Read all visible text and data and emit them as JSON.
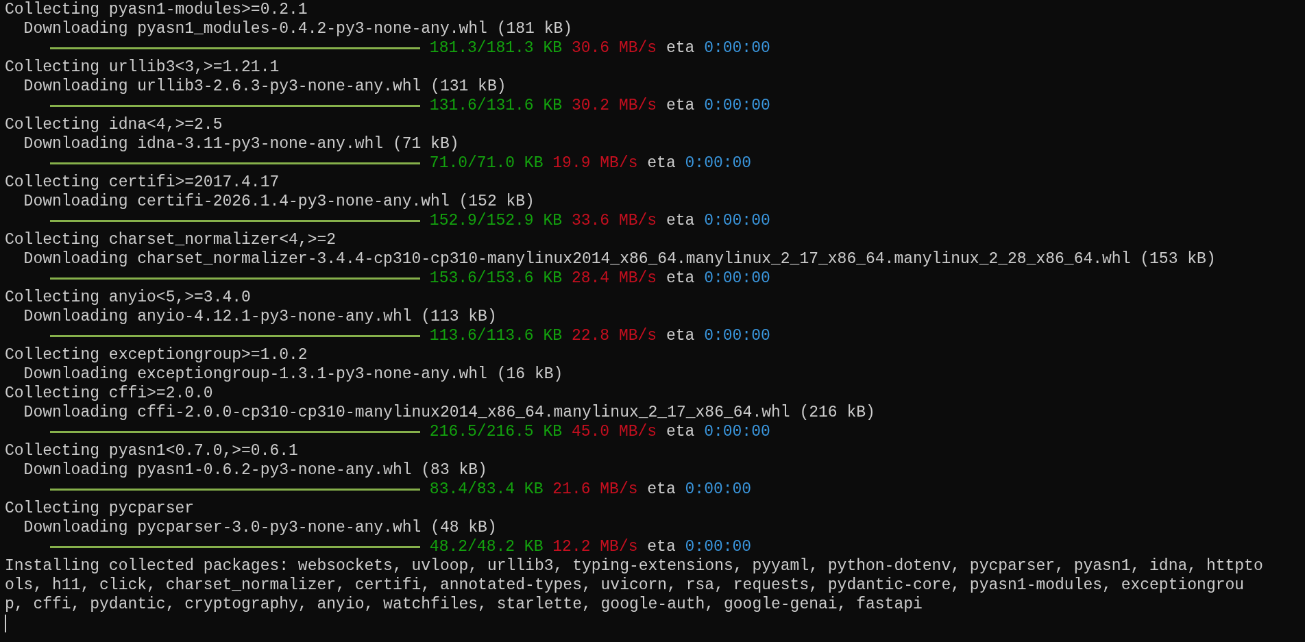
{
  "terminal": {
    "lines": [
      {
        "kind": "text",
        "text": "Collecting pyasn1-modules>=0.2.1"
      },
      {
        "kind": "text",
        "text": "  Downloading pyasn1_modules-0.4.2-py3-none-any.whl (181 kB)"
      },
      {
        "kind": "progress",
        "level": 1,
        "amount": "181.3/181.3 KB",
        "speed": "30.6 MB/s",
        "eta_label": "eta",
        "eta": "0:00:00"
      },
      {
        "kind": "text",
        "text": "Collecting urllib3<3,>=1.21.1"
      },
      {
        "kind": "text",
        "text": "  Downloading urllib3-2.6.3-py3-none-any.whl (131 kB)"
      },
      {
        "kind": "progress",
        "level": 1,
        "amount": "131.6/131.6 KB",
        "speed": "30.2 MB/s",
        "eta_label": "eta",
        "eta": "0:00:00"
      },
      {
        "kind": "text",
        "text": "Collecting idna<4,>=2.5"
      },
      {
        "kind": "text",
        "text": "  Downloading idna-3.11-py3-none-any.whl (71 kB)"
      },
      {
        "kind": "progress",
        "level": 1,
        "amount": "71.0/71.0 KB",
        "speed": "19.9 MB/s",
        "eta_label": "eta",
        "eta": "0:00:00"
      },
      {
        "kind": "text",
        "text": "Collecting certifi>=2017.4.17"
      },
      {
        "kind": "text",
        "text": "  Downloading certifi-2026.1.4-py3-none-any.whl (152 kB)"
      },
      {
        "kind": "progress",
        "level": 1,
        "amount": "152.9/152.9 KB",
        "speed": "33.6 MB/s",
        "eta_label": "eta",
        "eta": "0:00:00"
      },
      {
        "kind": "text",
        "text": "Collecting charset_normalizer<4,>=2"
      },
      {
        "kind": "text",
        "text": "  Downloading charset_normalizer-3.4.4-cp310-cp310-manylinux2014_x86_64.manylinux_2_17_x86_64.manylinux_2_28_x86_64.whl (153 kB)"
      },
      {
        "kind": "progress",
        "level": 1,
        "amount": "153.6/153.6 KB",
        "speed": "28.4 MB/s",
        "eta_label": "eta",
        "eta": "0:00:00"
      },
      {
        "kind": "text",
        "text": "Collecting anyio<5,>=3.4.0"
      },
      {
        "kind": "text",
        "text": "  Downloading anyio-4.12.1-py3-none-any.whl (113 kB)"
      },
      {
        "kind": "progress",
        "level": 1,
        "amount": "113.6/113.6 KB",
        "speed": "22.8 MB/s",
        "eta_label": "eta",
        "eta": "0:00:00"
      },
      {
        "kind": "text",
        "text": "Collecting exceptiongroup>=1.0.2"
      },
      {
        "kind": "text",
        "text": "  Downloading exceptiongroup-1.3.1-py3-none-any.whl (16 kB)"
      },
      {
        "kind": "text",
        "text": "Collecting cffi>=2.0.0"
      },
      {
        "kind": "text",
        "text": "  Downloading cffi-2.0.0-cp310-cp310-manylinux2014_x86_64.manylinux_2_17_x86_64.whl (216 kB)"
      },
      {
        "kind": "progress",
        "level": 1,
        "amount": "216.5/216.5 KB",
        "speed": "45.0 MB/s",
        "eta_label": "eta",
        "eta": "0:00:00"
      },
      {
        "kind": "text",
        "text": "Collecting pyasn1<0.7.0,>=0.6.1"
      },
      {
        "kind": "text",
        "text": "  Downloading pyasn1-0.6.2-py3-none-any.whl (83 kB)"
      },
      {
        "kind": "progress",
        "level": 1,
        "amount": "83.4/83.4 KB",
        "speed": "21.6 MB/s",
        "eta_label": "eta",
        "eta": "0:00:00"
      },
      {
        "kind": "text",
        "text": "Collecting pycparser"
      },
      {
        "kind": "text",
        "text": "  Downloading pycparser-3.0-py3-none-any.whl (48 kB)"
      },
      {
        "kind": "progress",
        "level": 1,
        "amount": "48.2/48.2 KB",
        "speed": "12.2 MB/s",
        "eta_label": "eta",
        "eta": "0:00:00"
      },
      {
        "kind": "text",
        "text": "Installing collected packages: websockets, uvloop, urllib3, typing-extensions, pyyaml, python-dotenv, pycparser, pyasn1, idna, httptools, h11, click, charset_normalizer, certifi, annotated-types, uvicorn, rsa, requests, pydantic-core, pyasn1-modules, exceptiongroup, cffi, pydantic, cryptography, anyio, watchfiles, starlette, google-auth, google-genai, fastapi"
      }
    ],
    "cursor_visible": true
  }
}
